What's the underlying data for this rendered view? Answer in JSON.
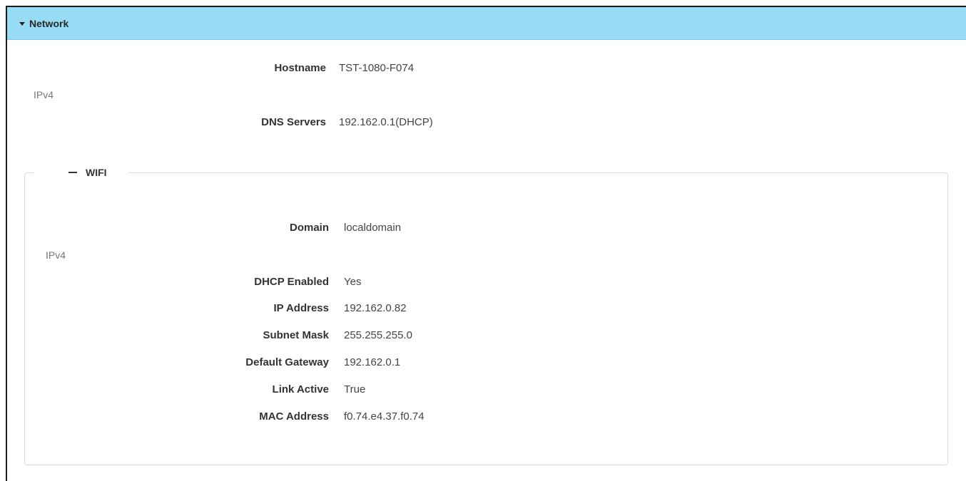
{
  "network": {
    "title": "Network",
    "hostname": {
      "label": "Hostname",
      "value": "TST-1080-F074"
    },
    "ipv4_label": "IPv4",
    "dns": {
      "label": "DNS Servers",
      "value": "192.162.0.1(DHCP)"
    }
  },
  "wifi": {
    "title": "WIFI",
    "domain": {
      "label": "Domain",
      "value": "localdomain"
    },
    "ipv4_label": "IPv4",
    "fields": [
      {
        "label": "DHCP Enabled",
        "value": "Yes"
      },
      {
        "label": "IP Address",
        "value": "192.162.0.82"
      },
      {
        "label": "Subnet Mask",
        "value": "255.255.255.0"
      },
      {
        "label": "Default Gateway",
        "value": "192.162.0.1"
      },
      {
        "label": "Link Active",
        "value": "True"
      },
      {
        "label": "MAC Address",
        "value": "f0.74.e4.37.f0.74"
      }
    ]
  },
  "colors": {
    "header_bg": "#97dcf4",
    "label_text": "#333333",
    "value_text": "#444444",
    "section_text": "#777777",
    "fieldset_border": "#dcdcdc"
  }
}
